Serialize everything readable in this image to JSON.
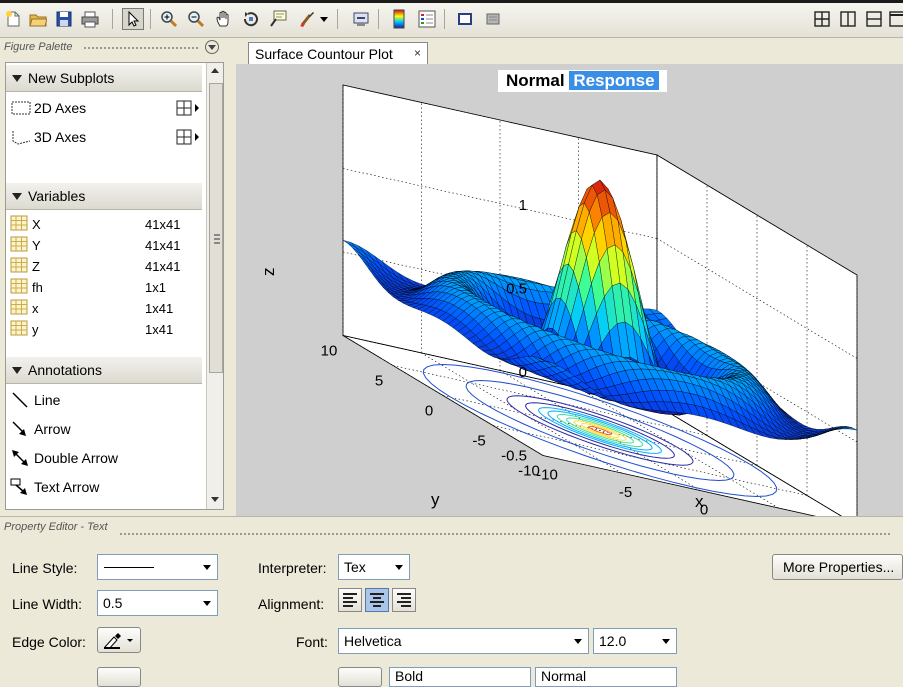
{
  "toolbar": {
    "icons": [
      "new-file-icon",
      "open-folder-icon",
      "save-icon",
      "print-icon",
      "select-arrow-icon",
      "zoom-in-icon",
      "zoom-out-icon",
      "pan-hand-icon",
      "rotate-3d-icon",
      "data-cursor-icon",
      "brush-icon",
      "link-icon",
      "colorbar-icon",
      "legend-icon",
      "hide-tools-icon",
      "show-tools-icon",
      "tile-icon",
      "split-vertical-icon",
      "split-horizontal-icon",
      "maximize-icon"
    ]
  },
  "palette": {
    "header": "Figure Palette",
    "sections": {
      "subplots": "New Subplots",
      "variables": "Variables",
      "annotations": "Annotations"
    },
    "subplots": [
      {
        "label": "2D Axes"
      },
      {
        "label": "3D Axes"
      }
    ],
    "variables": [
      {
        "name": "X",
        "size": "41x41"
      },
      {
        "name": "Y",
        "size": "41x41"
      },
      {
        "name": "Z",
        "size": "41x41"
      },
      {
        "name": "fh",
        "size": "1x1"
      },
      {
        "name": "x",
        "size": "1x41"
      },
      {
        "name": "y",
        "size": "1x41"
      }
    ],
    "annotations": [
      {
        "label": "Line"
      },
      {
        "label": "Arrow"
      },
      {
        "label": "Double Arrow"
      },
      {
        "label": "Text Arrow"
      }
    ]
  },
  "figure": {
    "tab_label": "Surface Countour Plot",
    "tab_close": "×",
    "title_normal": "Normal",
    "title_selected": "Response"
  },
  "chart_data": {
    "type": "surface",
    "title": "Normal Response",
    "xlabel": "x",
    "ylabel": "y",
    "zlabel": "z",
    "x_ticks": [
      "-10",
      "-5",
      "0",
      "5",
      "10"
    ],
    "y_ticks": [
      "-10",
      "-5",
      "0",
      "5",
      "10"
    ],
    "z_ticks": [
      "-0.5",
      "0",
      "0.5",
      "1"
    ],
    "xlim": [
      -10,
      10
    ],
    "ylim": [
      -10,
      10
    ],
    "zlim": [
      -0.5,
      1
    ],
    "peak_z": 1,
    "colormap": [
      "#1a1aa0",
      "#0050ff",
      "#00c8ff",
      "#40ff90",
      "#ffff00",
      "#ff8800",
      "#d01010"
    ],
    "contour_colors": [
      "#1f4fd0",
      "#2a2aa8",
      "#00b0ff",
      "#40e0a0",
      "#ffe040",
      "#ff6020"
    ]
  },
  "property_editor": {
    "header": "Property Editor - Text",
    "line_style_label": "Line Style:",
    "line_width_label": "Line Width:",
    "line_width_value": "0.5",
    "edge_color_label": "Edge Color:",
    "interpreter_label": "Interpreter:",
    "interpreter_value": "Tex",
    "alignment_label": "Alignment:",
    "font_label": "Font:",
    "font_value": "Helvetica",
    "font_size_value": "12.0",
    "more_properties": "More Properties...",
    "bottom_combo_1": "Bold",
    "bottom_combo_2": "Normal"
  }
}
